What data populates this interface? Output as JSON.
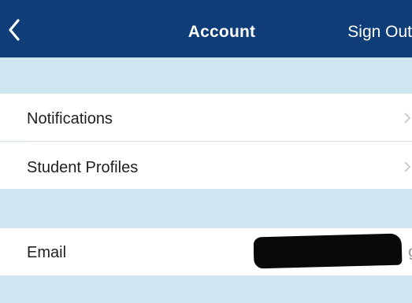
{
  "header": {
    "title": "Account",
    "sign_out_label": "Sign Out",
    "back_icon": "chevron-left-icon",
    "background_color": "#0f3d78"
  },
  "settings": {
    "notifications_label": "Notifications",
    "student_profiles_label": "Student Profiles",
    "email_label": "Email",
    "email_value": "g",
    "chevron_icon": "chevron-right-icon",
    "section_background_color": "#cfe6f1"
  }
}
